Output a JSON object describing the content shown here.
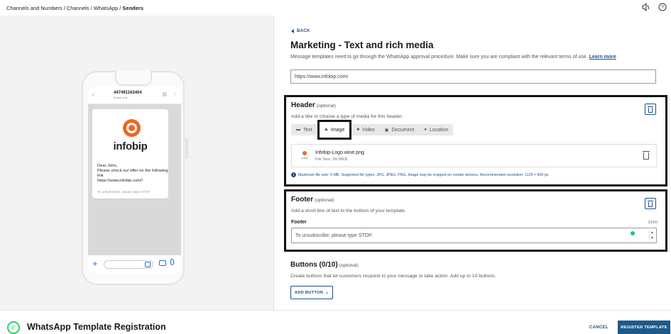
{
  "breadcrumb": {
    "items": [
      "Channels and Numbers",
      "Channels",
      "WhatsApp"
    ],
    "current": "Senders"
  },
  "preview": {
    "phone_number": "447491163404",
    "status": "Active now",
    "logo_text": "infobip",
    "message": "Dear John,\nPlease check our offer on the following link\nhttps://www.infobip.com/!",
    "footer": "To unsubscribe, please type STOP."
  },
  "form": {
    "back_label": "BACK",
    "title": "Marketing - Text and rich media",
    "description": "Message templates need to go through the WhatsApp approval procedure. Make sure you are compliant with the relevant terms of use.",
    "learn_more": "Learn more",
    "url_value": "https://www.infobip.com/"
  },
  "header_section": {
    "title": "Header",
    "optional": "(optional)",
    "description": "Add a title or choose a type of media for this header.",
    "tabs": [
      {
        "label": "Text",
        "icon": "text-icon"
      },
      {
        "label": "Image",
        "icon": "image-icon"
      },
      {
        "label": "Video",
        "icon": "video-icon"
      },
      {
        "label": "Document",
        "icon": "document-icon"
      },
      {
        "label": "Location",
        "icon": "location-icon"
      }
    ],
    "active_tab": "Image",
    "file_thumb_text": "infobip",
    "file_name": "Infobip-Logo.wine.png",
    "file_size": "File Size: 34.38KB",
    "info": "Maximum file size: 5 MB. Supported file types: JPG, JPEG, PNG. Image may be cropped on certain devices. Recommended resolution: 1125 × 600 px."
  },
  "footer_section": {
    "title": "Footer",
    "optional": "(optional)",
    "description": "Add a short line of text to the bottom of your template.",
    "field_label": "Footer",
    "counter": "33/60",
    "value": "To unsubscribe, please type STOP."
  },
  "buttons_section": {
    "title": "Buttons (0/10)",
    "optional": "(optional)",
    "description": "Create buttons that let customers respond to your message or take action. Add up to 10 buttons.",
    "add_label": "ADD BUTTON"
  },
  "bottom": {
    "app_title": "WhatsApp Template Registration",
    "cancel_label": "CANCEL",
    "register_label": "REGISTER TEMPLATE"
  },
  "colors": {
    "accent": "#1d4f8c",
    "primary_button": "#1d5a8a",
    "whatsapp_green": "#25d366",
    "infobip_orange": "#f26522"
  }
}
